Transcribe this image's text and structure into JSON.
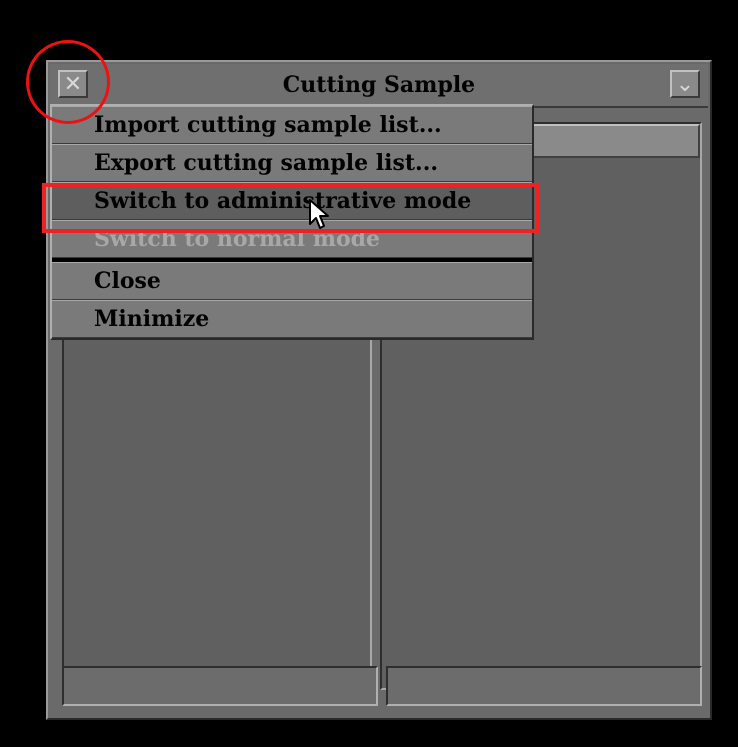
{
  "window": {
    "title": "Cutting Sample",
    "close_glyph": "✕",
    "menu_glyph": "⌄"
  },
  "menu": {
    "items": [
      {
        "label": "Import cutting sample list...",
        "state": "normal"
      },
      {
        "label": "Export cutting sample list...",
        "state": "normal"
      },
      {
        "label": "Switch to administrative mode",
        "state": "highlighted"
      },
      {
        "label": "Switch to normal mode",
        "state": "disabled"
      },
      {
        "label": "Close",
        "state": "normal"
      },
      {
        "label": "Minimize",
        "state": "normal"
      }
    ]
  },
  "colors": {
    "annotation": "#ee1111",
    "menu_bg": "#7a7a7a",
    "menu_highlight": "#5e5e5e"
  }
}
